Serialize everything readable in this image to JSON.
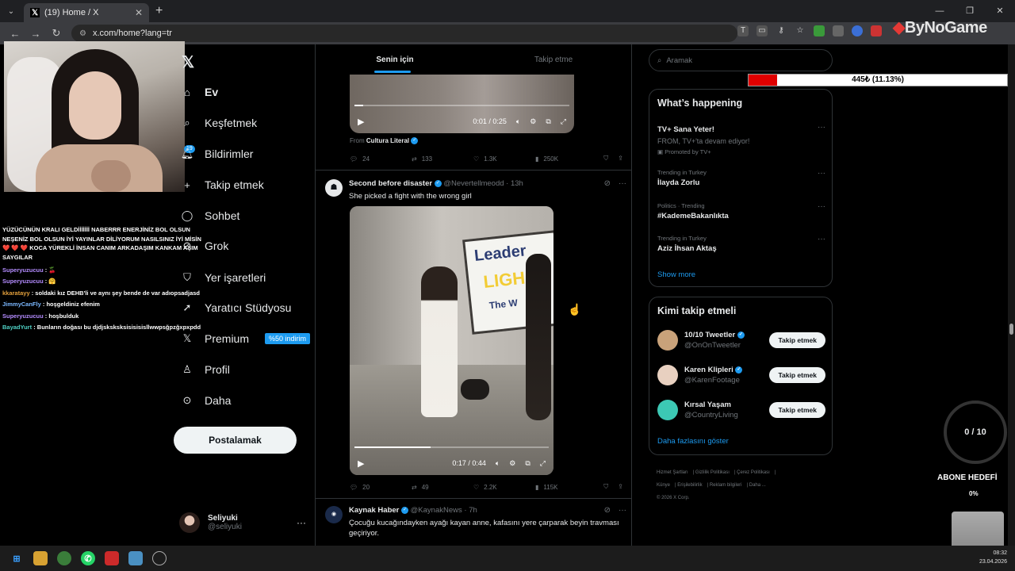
{
  "browser": {
    "tab_title": "(19) Home / X",
    "url": "x.com/home?lang=tr",
    "brand_overlay": "ByNoGame"
  },
  "chat": [
    {
      "user": "",
      "text": "YÜZÜCÜNÜN KRALI GELDİİİİİİİ NABERRR ENERJİNİZ BOL OLSUN NEŞENİZ BOL OLSUN İYİ YAYINLAR DİLİYORUM NASILSINIZ İYİ MİSİN ❤️ ❤️ ❤️ KOCA YÜREKLİ İNSAN CANIM ARKADAŞIM KANKAM AŞIM SAYGILAR"
    },
    {
      "user": "Superyuzucuu",
      "text": ": 🍒"
    },
    {
      "user": "Superyuzucuu",
      "text": ": 🤗"
    },
    {
      "user": "kkaratayy",
      "text": ": soldaki kız DEHB'li ve aynı şey bende de var adıopsadjasd"
    },
    {
      "user": "JimmyCanFly",
      "text": ": hoşgeldiniz efenim"
    },
    {
      "user": "Superyuzucuu",
      "text": ": hoşbulduk"
    },
    {
      "user": "BayadYurt",
      "text": ": Bunların doğası bu djdjsksksksisisisisllwwpsğpzğxpxpdd"
    }
  ],
  "nav": {
    "items": [
      {
        "label": "Ev",
        "icon": "home-icon"
      },
      {
        "label": "Keşfetmek",
        "icon": "search-icon"
      },
      {
        "label": "Bildirimler",
        "icon": "bell-icon",
        "badge": "19"
      },
      {
        "label": "Takip etmek",
        "icon": "add-user-icon"
      },
      {
        "label": "Sohbet",
        "icon": "chat-icon"
      },
      {
        "label": "Grok",
        "icon": "grok-icon"
      },
      {
        "label": "Yer işaretleri",
        "icon": "bookmark-icon"
      },
      {
        "label": "Yaratıcı Stüdyosu",
        "icon": "rocket-icon"
      },
      {
        "label": "Premium",
        "icon": "x-icon",
        "badge": "%50 indirim"
      },
      {
        "label": "Profil",
        "icon": "profile-icon"
      },
      {
        "label": "Daha",
        "icon": "more-icon"
      }
    ],
    "post_label": "Postalamak"
  },
  "account": {
    "name": "Seliyuki",
    "handle": "@seliyuki"
  },
  "feed": {
    "tabs": [
      "Senin için",
      "Takip etme"
    ],
    "tweet1": {
      "video_time": "0:01 / 0:25",
      "video_progress": 0.04,
      "from_label": "From",
      "from_source": "Cultura Literal",
      "replies": "24",
      "reposts": "133",
      "likes": "1.3K",
      "views": "250K"
    },
    "tweet2": {
      "name": "Second before disaster",
      "handle": "@Nevertellmeodd",
      "time": "13h",
      "text": "She picked a fight with the wrong girl",
      "board_lines": [
        "Leader",
        "LIGH",
        "The W"
      ],
      "video_time": "0:17 / 0:44",
      "video_progress": 0.39,
      "replies": "20",
      "reposts": "49",
      "likes": "2.2K",
      "views": "115K"
    },
    "tweet3": {
      "name": "Kaynak Haber",
      "handle": "@KaynakNews",
      "time": "7h",
      "text": "Çocuğu kucağındayken ayağı kayan anne, kafasını yere çarparak beyin travması geçiriyor."
    }
  },
  "sidebar": {
    "search_placeholder": "Aramak",
    "whats_happening": {
      "title": "What’s happening",
      "ad": {
        "title": "TV+ Sana Yeter!",
        "sub": "FROM, TV+'ta devam ediyor!",
        "promo": "Promoted by TV+"
      },
      "trends": [
        {
          "ctx": "Trending in Turkey",
          "title": "İlayda Zorlu"
        },
        {
          "ctx": "Politics · Trending",
          "title": "#KademeBakanlıkta"
        },
        {
          "ctx": "Trending in Turkey",
          "title": "Aziz İhsan Aktaş"
        }
      ],
      "show_more": "Show more"
    },
    "who_to_follow": {
      "title": "Kimi takip etmeli",
      "follow_label": "Takip etmek",
      "users": [
        {
          "name": "10/10 Tweetler",
          "handle": "@OnOnTweetler",
          "color": "#c9a27a"
        },
        {
          "name": "Karen Klipleri",
          "handle": "@KarenFootage",
          "color": "#e8d0c0"
        },
        {
          "name": "Kırsal Yaşam",
          "handle": "@CountryLiving",
          "color": "#3cc8b4"
        }
      ],
      "show_more": "Daha fazlasını göster"
    },
    "footer": [
      "Hizmet Şartları",
      "Gizlilik Politikası",
      "Çerez Politikası",
      "Künye",
      "Erişilebilirlik",
      "Reklam bilgileri",
      "Daha ...",
      "© 2026 X Corp."
    ]
  },
  "overlays": {
    "donation_text": "445₺ (11.13%)",
    "donation_progress": 0.1113,
    "sub_counter": "0 / 10",
    "sub_goal": "ABONE HEDEFİ",
    "sub_goal_pct": "0%"
  },
  "taskbar": {
    "time": "08:32",
    "date": "23.04.2026"
  },
  "colors": {
    "accent": "#1d9bf0",
    "bg": "#000000",
    "donation": "#e00000"
  }
}
